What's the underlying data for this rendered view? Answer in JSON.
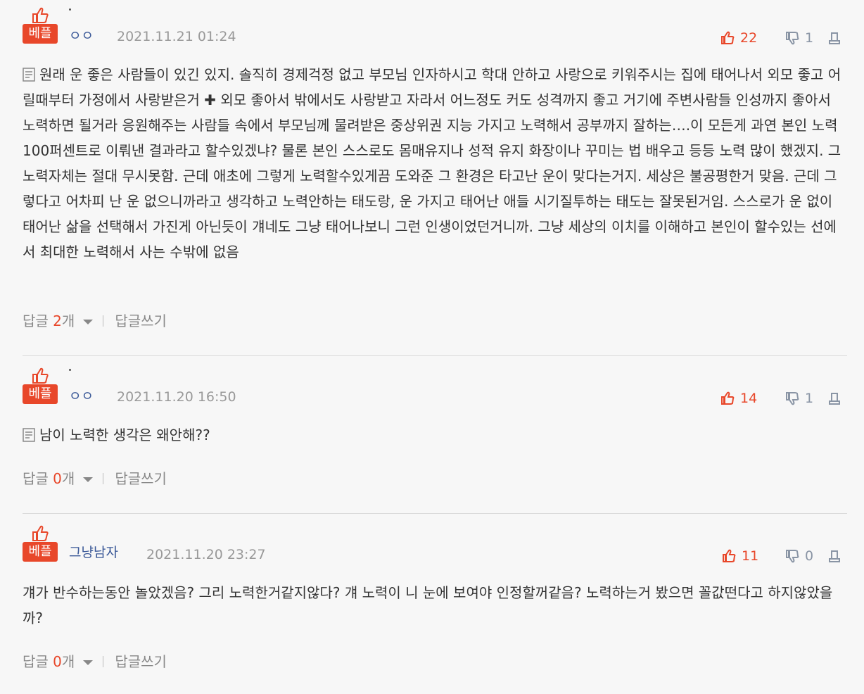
{
  "labels": {
    "best": "베플",
    "reply_prefix": "답글 ",
    "reply_suffix": "개",
    "write_reply": "답글쓰기"
  },
  "comments": [
    {
      "nickname": "ㅇㅇ",
      "date": "2021.11.21 01:24",
      "likes": "22",
      "dislikes": "1",
      "text": "원래 운 좋은 사람들이 있긴 있지. 솔직히 경제걱정 없고 부모님 인자하시고 학대 안하고 사랑으로 키워주시는 집에 태어나서 외모 좋고 어릴때부터 가정에서 사랑받은거 ✚ 외모 좋아서 밖에서도 사랑받고 자라서 어느정도 커도 성격까지 좋고 거기에 주변사람들 인성까지 좋아서 노력하면 될거라 응원해주는 사람들 속에서 부모님께 물려받은 중상위권 지능 가지고 노력해서 공부까지 잘하는….이 모든게 과연 본인 노력 100퍼센트로 이뤄낸 결과라고 할수있겠냐? 물론 본인 스스로도 몸매유지나 성적 유지 화장이나 꾸미는 법 배우고 등등 노력 많이 했겠지. 그 노력자체는 절대 무시못함. 근데 애초에 그렇게 노력할수있게끔 도와준 그 환경은 타고난 운이 맞다는거지. 세상은 불공평한거 맞음. 근데 그렇다고 어차피 난 운 없으니까라고 생각하고 노력안하는 태도랑, 운 가지고 태어난 애들 시기질투하는 태도는 잘못된거임. 스스로가 운 없이 태어난 삶을 선택해서 가진게 아닌듯이 걔네도 그냥 태어나보니 그런 인생이었던거니까. 그냥 세상의 이치를 이해하고 본인이 할수있는 선에서 최대한 노력해서 사는 수밖에 없음",
      "reply_count": "2"
    },
    {
      "nickname": "ㅇㅇ",
      "date": "2021.11.20 16:50",
      "likes": "14",
      "dislikes": "1",
      "text": "남이 노력한 생각은 왜안해??",
      "reply_count": "0"
    },
    {
      "nickname": "그냥남자",
      "date": "2021.11.20 23:27",
      "likes": "11",
      "dislikes": "0",
      "text": "걔가 반수하는동안 놀았겠음? 그리 노력한거같지않다? 걔 노력이 니 눈에 보여야 인정할꺼같음? 노력하는거 봤으면 꼴값떤다고 하지않았을까?",
      "reply_count": "0"
    }
  ],
  "colors": {
    "accent": "#e8472a",
    "nickname": "#3b5998",
    "muted": "#999999",
    "background": "#f7f7f7"
  }
}
